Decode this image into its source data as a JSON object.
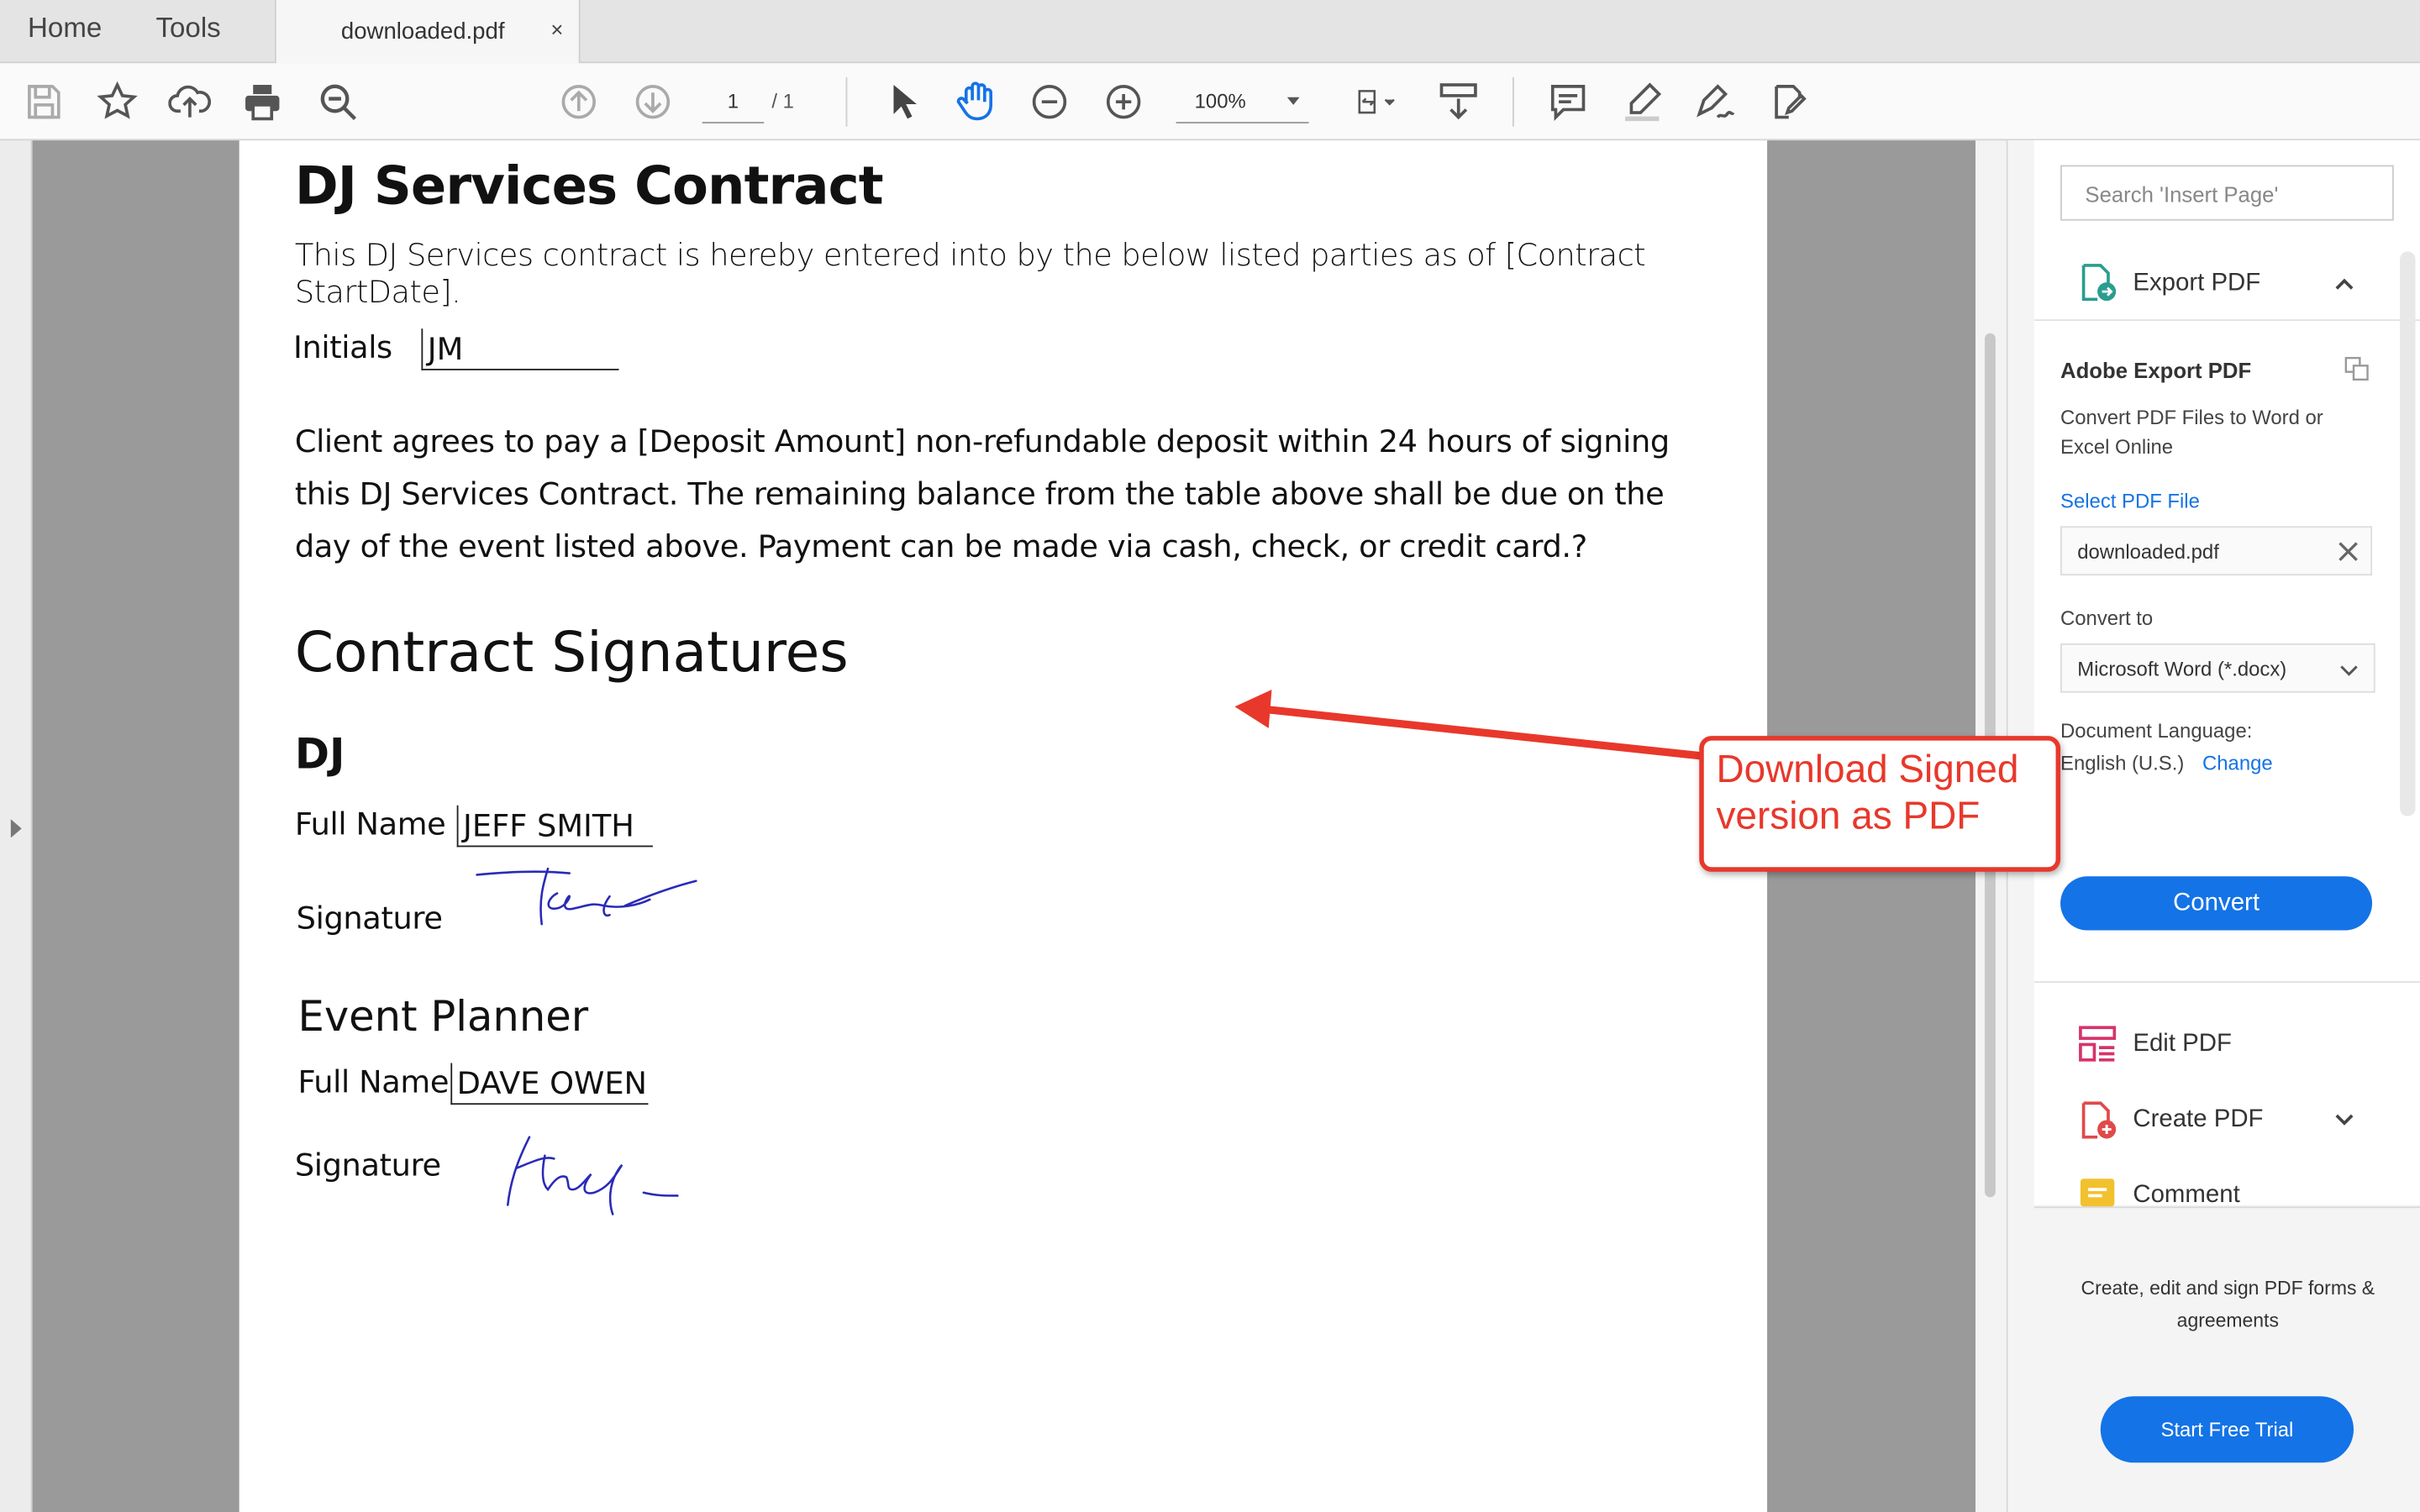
{
  "tabs": {
    "home": "Home",
    "tools": "Tools",
    "document": "downloaded.pdf",
    "close": "×"
  },
  "toolbar": {
    "page_current": "1",
    "page_total": "/ 1",
    "zoom": "100%",
    "icons": [
      "save-icon",
      "bookmark-star-icon",
      "upload-cloud-icon",
      "print-icon",
      "search-zoom-icon",
      "page-up-icon",
      "page-down-icon",
      "select-pointer-icon",
      "hand-tool-icon",
      "zoom-out-icon",
      "zoom-in-icon",
      "page-fit-icon",
      "scroll-mode-icon",
      "comment-icon",
      "highlight-pen-icon",
      "sign-pen-icon",
      "fill-sign-icon"
    ]
  },
  "document": {
    "title": "DJ Services Contract",
    "intro": "This DJ Services contract is hereby entered into by the below listed parties as of [Contract StartDate].",
    "initials_label": "Initials",
    "initials_value": "JM",
    "payment_paragraph": "Client agrees to pay a [Deposit Amount] non-refundable deposit within 24 hours of signing this DJ Services Contract. The remaining balance from the table above shall be due on the day of the event listed above. Payment can be made via cash, check, or credit card.?",
    "signatures_heading": "Contract Signatures",
    "dj": {
      "heading": "DJ",
      "full_name_label": "Full Name",
      "full_name_value": "JEFF SMITH",
      "signature_label": "Signature"
    },
    "planner": {
      "heading": "Event Planner",
      "full_name_label": "Full Name",
      "full_name_value": "DAVE OWEN",
      "signature_label": "Signature"
    }
  },
  "sidebar": {
    "search_placeholder": "Search 'Insert Page'",
    "export": {
      "title": "Export PDF",
      "heading": "Adobe Export PDF",
      "description": "Convert PDF Files to Word or Excel Online",
      "select_file_link": "Select PDF File",
      "file_name": "downloaded.pdf",
      "convert_to_label": "Convert to",
      "format": "Microsoft Word (*.docx)",
      "language_label": "Document Language:",
      "language_value": "English (U.S.)",
      "change_link": "Change",
      "convert_button": "Convert"
    },
    "tools": [
      {
        "label": "Edit PDF"
      },
      {
        "label": "Create PDF"
      },
      {
        "label": "Comment"
      }
    ],
    "promo_text": "Create, edit and sign PDF forms & agreements",
    "trial_button": "Start Free Trial"
  },
  "callout": {
    "text": "Download Signed version as PDF"
  },
  "colors": {
    "accent_blue": "#1473e6",
    "callout_red": "#e8382b",
    "signature_ink": "#2a2ab8"
  }
}
